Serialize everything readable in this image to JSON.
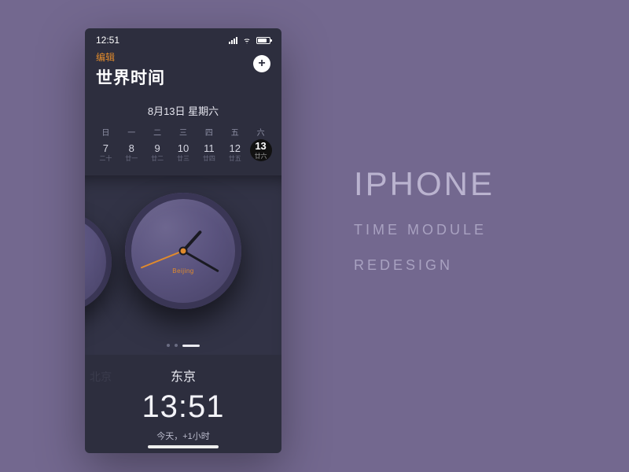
{
  "statusbar": {
    "time": "12:51"
  },
  "header": {
    "edit": "编辑",
    "title": "世界时间"
  },
  "date_label": "8月13日 星期六",
  "week": {
    "heads": [
      "日",
      "一",
      "二",
      "三",
      "四",
      "五",
      "六"
    ],
    "days": [
      {
        "num": "7",
        "sub": "二十"
      },
      {
        "num": "8",
        "sub": "廿一"
      },
      {
        "num": "9",
        "sub": "廿二"
      },
      {
        "num": "10",
        "sub": "廿三"
      },
      {
        "num": "11",
        "sub": "廿四"
      },
      {
        "num": "12",
        "sub": "廿五"
      },
      {
        "num": "13",
        "sub": "廿六",
        "today": true
      }
    ]
  },
  "clock": {
    "brand": "Beijing"
  },
  "city": {
    "side": "北京",
    "name": "东京",
    "time": "13:51",
    "sub": "今天，+1小时"
  },
  "caption": {
    "l1": "IPHONE",
    "l2": "TIME MODULE",
    "l3": "REDESIGN"
  }
}
